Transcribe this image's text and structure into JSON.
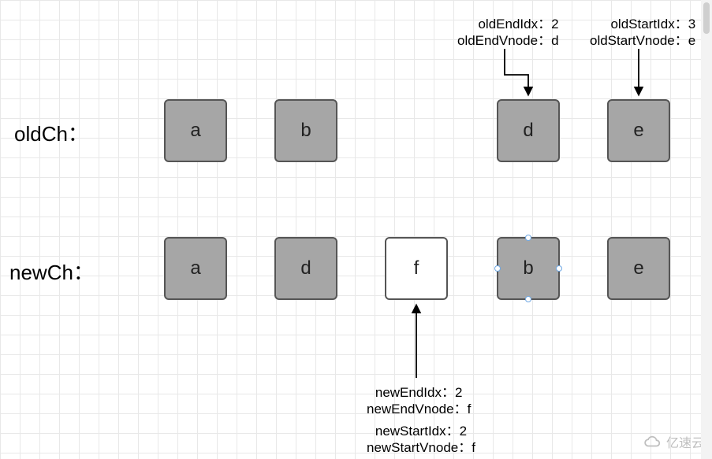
{
  "labels": {
    "oldCh": "oldCh：",
    "newCh": "newCh："
  },
  "annotations": {
    "oldEnd": {
      "idxLabel": "oldEndIdx：2",
      "vnodeLabel": "oldEndVnode：d"
    },
    "oldStart": {
      "idxLabel": "oldStartIdx：3",
      "vnodeLabel": "oldStartVnode：e"
    },
    "newEnd": {
      "idxLabel": "newEndIdx：2",
      "vnodeLabel": "newEndVnode：f"
    },
    "newStart": {
      "idxLabel": "newStartIdx：2",
      "vnodeLabel": "newStartVnode：f"
    }
  },
  "oldCh": {
    "0": "a",
    "1": "b",
    "2": "d",
    "3": "e"
  },
  "newCh": {
    "0": "a",
    "1": "d",
    "2": "f",
    "3": "b",
    "4": "e"
  },
  "watermark": "亿速云",
  "chart_data": {
    "type": "table",
    "title": "Virtual DOM diff pointer state",
    "series": [
      {
        "name": "oldCh",
        "values": [
          "a",
          "b",
          "d",
          "e"
        ]
      },
      {
        "name": "newCh",
        "values": [
          "a",
          "d",
          "f",
          "b",
          "e"
        ]
      }
    ],
    "pointers": {
      "oldEndIdx": 2,
      "oldEndVnode": "d",
      "oldStartIdx": 3,
      "oldStartVnode": "e",
      "newEndIdx": 2,
      "newEndVnode": "f",
      "newStartIdx": 2,
      "newStartVnode": "f"
    }
  }
}
